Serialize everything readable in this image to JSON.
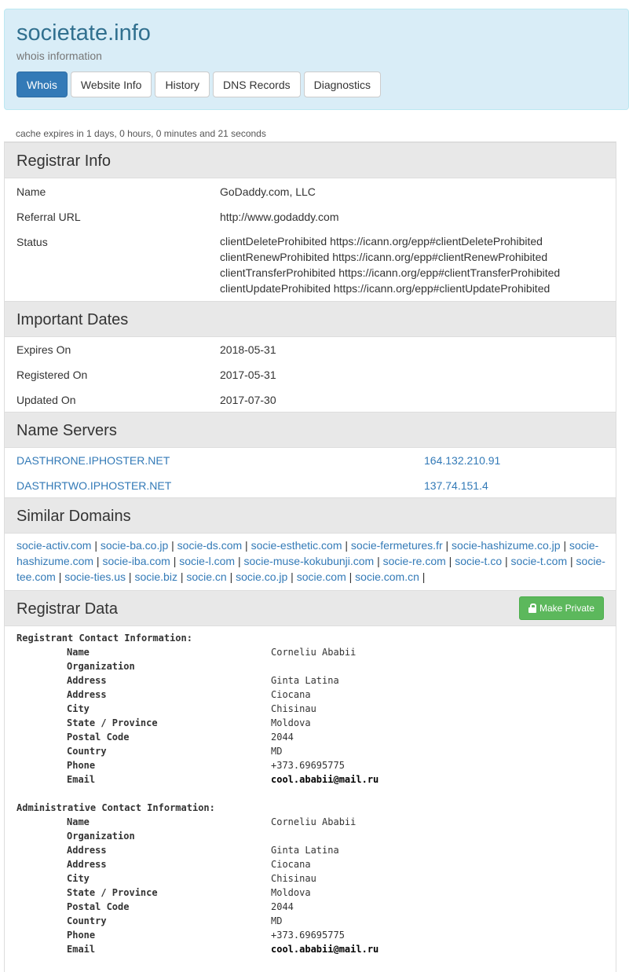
{
  "header": {
    "title": "societate.info",
    "subtitle": "whois information",
    "tabs": [
      "Whois",
      "Website Info",
      "History",
      "DNS Records",
      "Diagnostics"
    ]
  },
  "cache_note": "cache expires in 1 days, 0 hours, 0 minutes and 21 seconds",
  "registrar_info": {
    "heading": "Registrar Info",
    "name_label": "Name",
    "name_value": "GoDaddy.com, LLC",
    "url_label": "Referral URL",
    "url_value": "http://www.godaddy.com",
    "status_label": "Status",
    "status_values": [
      "clientDeleteProhibited https://icann.org/epp#clientDeleteProhibited",
      "clientRenewProhibited https://icann.org/epp#clientRenewProhibited",
      "clientTransferProhibited https://icann.org/epp#clientTransferProhibited",
      "clientUpdateProhibited https://icann.org/epp#clientUpdateProhibited"
    ]
  },
  "important_dates": {
    "heading": "Important Dates",
    "expires_label": "Expires On",
    "expires_value": "2018-05-31",
    "registered_label": "Registered On",
    "registered_value": "2017-05-31",
    "updated_label": "Updated On",
    "updated_value": "2017-07-30"
  },
  "name_servers": {
    "heading": "Name Servers",
    "servers": [
      {
        "host": "DASTHRONE.IPHOSTER.NET",
        "ip": "164.132.210.91"
      },
      {
        "host": "DASTHRTWO.IPHOSTER.NET",
        "ip": "137.74.151.4"
      }
    ]
  },
  "similar_domains": {
    "heading": "Similar Domains",
    "domains": [
      "socie-activ.com",
      "socie-ba.co.jp",
      "socie-ds.com",
      "socie-esthetic.com",
      "socie-fermetures.fr",
      "socie-hashizume.co.jp",
      "socie-hashizume.com",
      "socie-iba.com",
      "socie-l.com",
      "socie-muse-kokubunji.com",
      "socie-re.com",
      "socie-t.co",
      "socie-t.com",
      "socie-tee.com",
      "socie-ties.us",
      "socie.biz",
      "socie.cn",
      "socie.co.jp",
      "socie.com",
      "socie.com.cn"
    ]
  },
  "registrar_data": {
    "heading": "Registrar Data",
    "make_private_label": "Make Private",
    "registrant": {
      "title": "Registrant Contact Information:",
      "fields": [
        {
          "label": "Name",
          "value": "Corneliu Ababii"
        },
        {
          "label": "Organization",
          "value": ""
        },
        {
          "label": "Address",
          "value": "Ginta Latina"
        },
        {
          "label": "Address",
          "value": "Ciocana"
        },
        {
          "label": "City",
          "value": "Chisinau"
        },
        {
          "label": "State / Province",
          "value": "Moldova"
        },
        {
          "label": "Postal Code",
          "value": "2044"
        },
        {
          "label": "Country",
          "value": "MD"
        },
        {
          "label": "Phone",
          "value": "+373.69695775"
        },
        {
          "label": "Email",
          "value": "cool.ababii@mail.ru"
        }
      ]
    },
    "administrative": {
      "title": "Administrative Contact Information:",
      "fields": [
        {
          "label": "Name",
          "value": "Corneliu Ababii"
        },
        {
          "label": "Organization",
          "value": ""
        },
        {
          "label": "Address",
          "value": "Ginta Latina"
        },
        {
          "label": "Address",
          "value": "Ciocana"
        },
        {
          "label": "City",
          "value": "Chisinau"
        },
        {
          "label": "State / Province",
          "value": "Moldova"
        },
        {
          "label": "Postal Code",
          "value": "2044"
        },
        {
          "label": "Country",
          "value": "MD"
        },
        {
          "label": "Phone",
          "value": "+373.69695775"
        },
        {
          "label": "Email",
          "value": "cool.ababii@mail.ru"
        }
      ]
    }
  }
}
